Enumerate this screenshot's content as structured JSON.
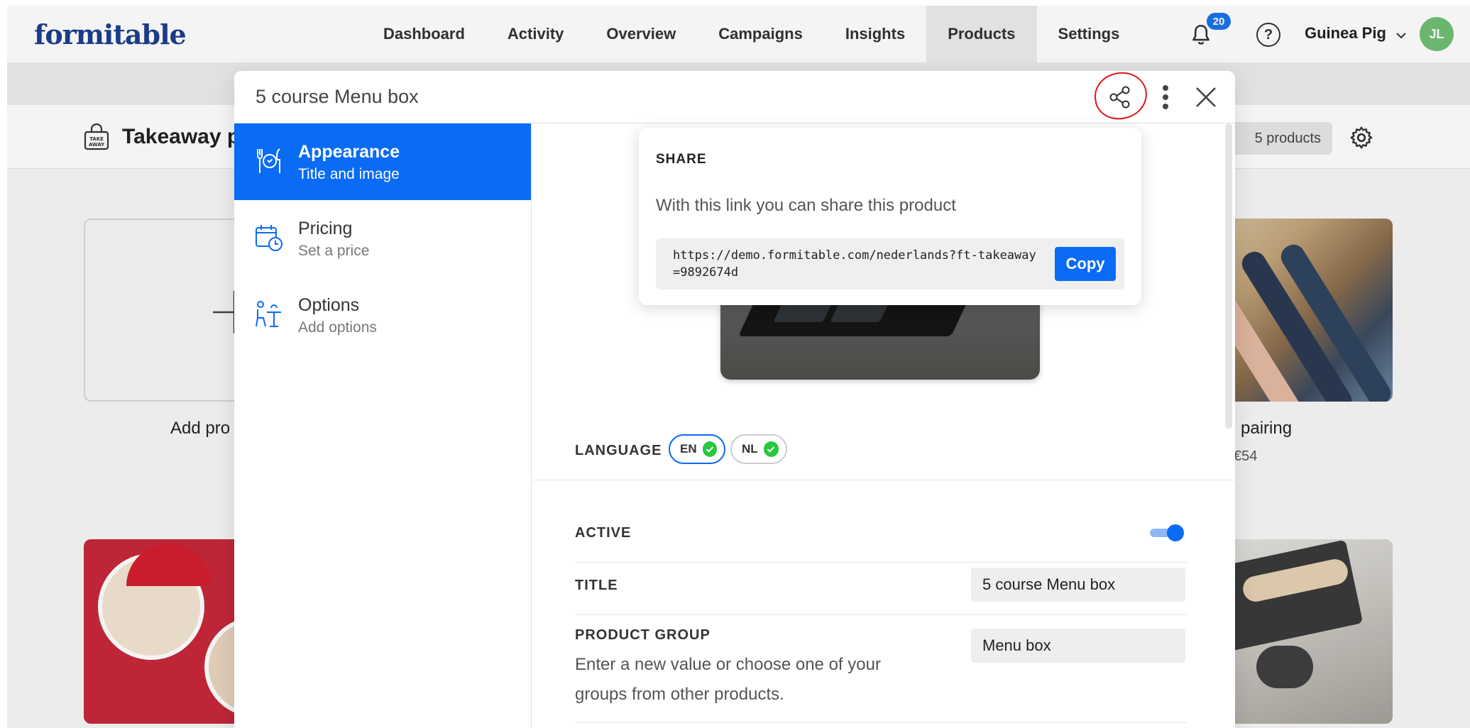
{
  "app": {
    "logo": "formitable",
    "nav": [
      "Dashboard",
      "Activity",
      "Overview",
      "Campaigns",
      "Insights",
      "Products",
      "Settings"
    ],
    "active_nav": "Products",
    "notifications": "20",
    "help": "?",
    "user": "Guinea Pig",
    "avatar_initials": "JL",
    "page_title": "Takeaway p",
    "products_count": "5 products",
    "add_product_label": "Add pro",
    "pairing_label": "pairing",
    "pairing_price": "€54"
  },
  "modal": {
    "title": "5 course Menu box",
    "sidebar": [
      {
        "title": "Appearance",
        "subtitle": "Title and image",
        "icon": "plate-icon",
        "active": true
      },
      {
        "title": "Pricing",
        "subtitle": "Set a price",
        "icon": "calendar-clock-icon",
        "active": false
      },
      {
        "title": "Options",
        "subtitle": "Add options",
        "icon": "options-person-icon",
        "active": false
      }
    ],
    "language": {
      "label": "LANGUAGE",
      "options": [
        {
          "code": "EN",
          "selected": true
        },
        {
          "code": "NL",
          "selected": false
        }
      ]
    },
    "fields": {
      "active_label": "ACTIVE",
      "active": true,
      "title_label": "TITLE",
      "title_value": "5 course Menu box",
      "group_label": "PRODUCT GROUP",
      "group_help": "Enter a new value or choose one of your groups from other products.",
      "group_value": "Menu box"
    }
  },
  "share": {
    "title": "SHARE",
    "description": "With this link you can share this product",
    "url": "https://demo.formitable.com/nederlands?ft-takeaway=9892674d",
    "copy_label": "Copy"
  },
  "colors": {
    "accent": "#0a6bf5",
    "brand": "#1c3f8f",
    "highlight_circle": "#e0141a",
    "check": "#28c840"
  }
}
